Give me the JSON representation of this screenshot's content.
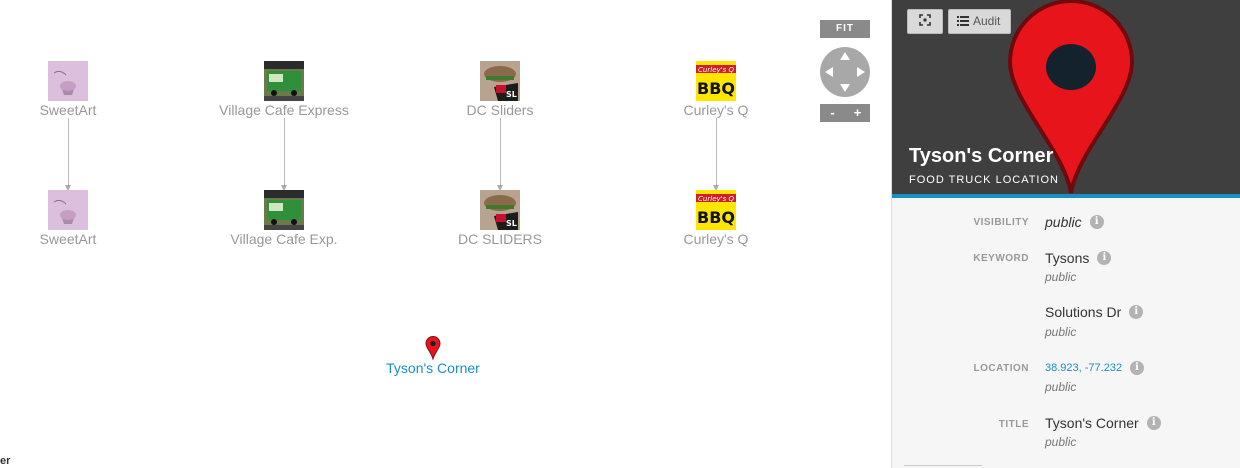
{
  "graph": {
    "nodes_top": [
      {
        "label": "SweetArt",
        "image": "sweetart-cupcake-thumbnail"
      },
      {
        "label": "Village Cafe Express",
        "image": "green-food-truck-thumbnail"
      },
      {
        "label": "DC Sliders",
        "image": "dc-sliders-burger-thumbnail"
      },
      {
        "label": "Curley's Q",
        "image": "curleys-q-bbq-logo"
      }
    ],
    "nodes_bottom": [
      {
        "label": "SweetArt",
        "image": "sweetart-cupcake-thumbnail"
      },
      {
        "label": "Village Cafe Exp.",
        "image": "green-food-truck-thumbnail"
      },
      {
        "label": "DC SLIDERS",
        "image": "dc-sliders-burger-thumbnail"
      },
      {
        "label": "Curley's Q",
        "image": "curleys-q-bbq-logo"
      }
    ],
    "location_node": {
      "label": "Tyson's Corner",
      "icon": "map-pin-icon"
    },
    "cut_off_label": "er"
  },
  "controls": {
    "fit": "FIT",
    "zoom_out": "-",
    "zoom_in": "+"
  },
  "panel": {
    "toolbar": {
      "expand_icon": "expand-icon",
      "audit_label": "Audit",
      "audit_icon": "list-icon"
    },
    "title": "Tyson's Corner",
    "subtitle": "FOOD TRUCK LOCATION",
    "header_icon": "map-pin-icon",
    "colors": {
      "header_bg": "#3f3f3f",
      "accent": "#1a8fc2",
      "pin_red": "#e8141c",
      "pin_dot": "#14222e"
    },
    "properties": {
      "visibility": {
        "key": "VISIBILITY",
        "value": "public"
      },
      "keyword": {
        "key": "KEYWORD",
        "values": [
          {
            "value": "Tysons",
            "visibility": "public"
          },
          {
            "value": "Solutions Dr",
            "visibility": "public"
          }
        ]
      },
      "location": {
        "key": "LOCATION",
        "value": "38.923, -77.232",
        "visibility": "public"
      },
      "title": {
        "key": "TITLE",
        "value": "Tyson's Corner",
        "visibility": "public"
      }
    }
  }
}
